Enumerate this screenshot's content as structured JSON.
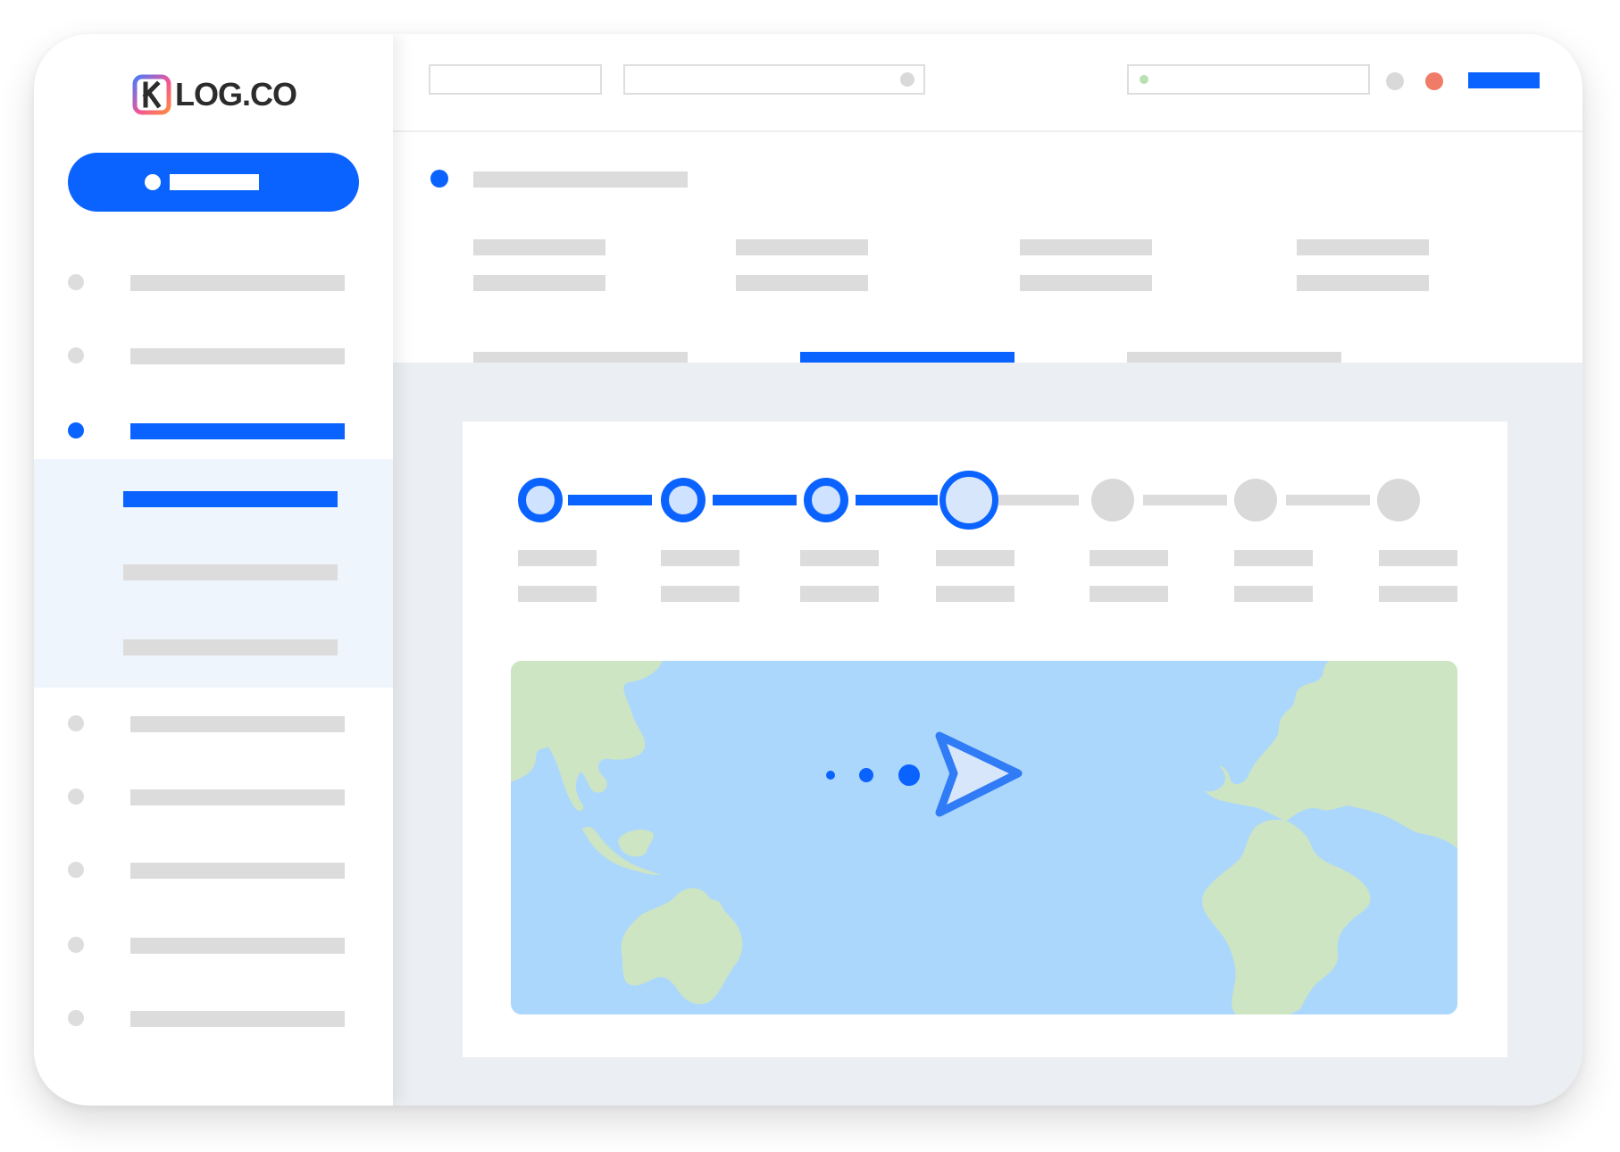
{
  "app": {
    "logo_text": "LOG.CO",
    "logo_mark": "K"
  },
  "colors": {
    "accent": "#0b63ff",
    "placeholder": "#dcdcdc",
    "sidebar_active_bg": "#eef5fd",
    "content_bg": "#ebeef2",
    "map_water": "#acd7fc",
    "map_land": "#cde5c3",
    "status_green": "#b9e0b0",
    "notification_red": "#f07c68"
  },
  "icons": {
    "logo": "k-logo-icon",
    "search": "search-icon",
    "status": "status-dot-icon",
    "profile": "profile-icon",
    "notification": "notification-icon",
    "shipment": "shipment-arrow-icon"
  },
  "sidebar": {
    "primary_button": {
      "label": ""
    },
    "items": [
      {
        "label": "",
        "active": false
      },
      {
        "label": "",
        "active": false
      },
      {
        "label": "",
        "active": true
      },
      {
        "label": "",
        "active": false
      },
      {
        "label": "",
        "active": false
      },
      {
        "label": "",
        "active": false
      },
      {
        "label": "",
        "active": false
      },
      {
        "label": "",
        "active": false
      }
    ],
    "subitems": [
      {
        "label": "",
        "active": true
      },
      {
        "label": "",
        "active": false
      },
      {
        "label": "",
        "active": false
      }
    ]
  },
  "header": {
    "filter_value": "",
    "search_value": "",
    "status_value": "",
    "action_label": ""
  },
  "details": {
    "title": "",
    "fields": [
      {
        "label": "",
        "value": ""
      },
      {
        "label": "",
        "value": ""
      },
      {
        "label": "",
        "value": ""
      },
      {
        "label": "",
        "value": ""
      }
    ],
    "tabs": [
      {
        "label": "",
        "active": false
      },
      {
        "label": "",
        "active": true
      },
      {
        "label": "",
        "active": false
      }
    ]
  },
  "timeline": {
    "current_step": 4,
    "steps": [
      {
        "status": "done",
        "label": "",
        "sublabel": ""
      },
      {
        "status": "done",
        "label": "",
        "sublabel": ""
      },
      {
        "status": "done",
        "label": "",
        "sublabel": ""
      },
      {
        "status": "current",
        "label": "",
        "sublabel": ""
      },
      {
        "status": "todo",
        "label": "",
        "sublabel": ""
      },
      {
        "status": "todo",
        "label": "",
        "sublabel": ""
      },
      {
        "status": "todo",
        "label": "",
        "sublabel": ""
      }
    ]
  },
  "map": {
    "route_direction": "east"
  }
}
